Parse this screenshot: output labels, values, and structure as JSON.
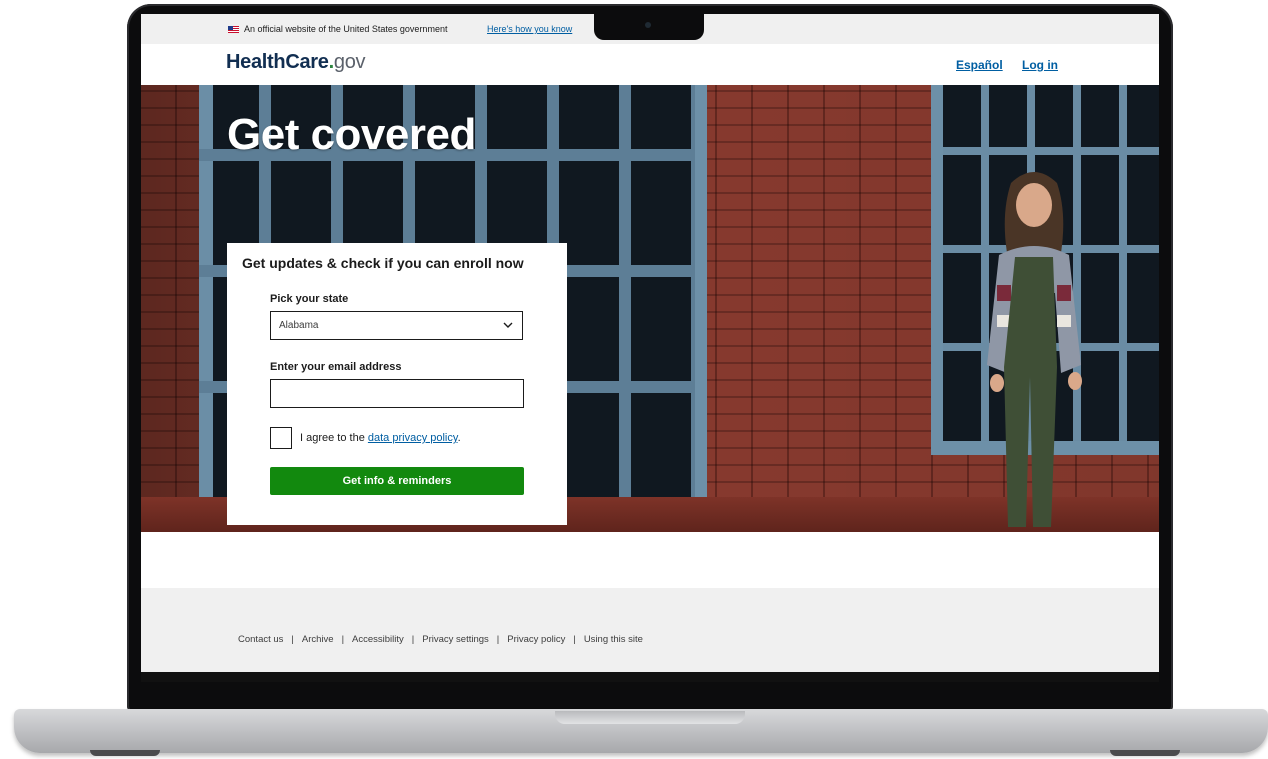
{
  "gov_banner": {
    "text": "An official website of the United States government",
    "link": "Here's how you know"
  },
  "header": {
    "logo_bold": "HealthCare",
    "logo_dot": ".",
    "logo_tld": "gov",
    "lang_link": "Español",
    "login_link": "Log in"
  },
  "hero": {
    "title": "Get covered"
  },
  "form": {
    "title": "Get updates & check if you can enroll now",
    "state_label": "Pick your state",
    "state_value": "Alabama",
    "email_label": "Enter your email address",
    "email_value": "",
    "agree_prefix": "I agree to the ",
    "agree_link": "data privacy policy",
    "agree_suffix": ".",
    "submit_label": "Get info & reminders",
    "checkbox_checked": false
  },
  "footer": {
    "links": [
      "Contact us",
      "Archive",
      "Accessibility",
      "Privacy settings",
      "Privacy policy",
      "Using this site"
    ],
    "separator": "|"
  },
  "colors": {
    "brand_navy": "#112e51",
    "link_blue": "#005ea2",
    "submit_green": "#12890e",
    "logo_dot_green": "#2e8540"
  },
  "icons": {
    "flag": "us-flag-icon",
    "select_caret": "chevron-down-icon"
  }
}
